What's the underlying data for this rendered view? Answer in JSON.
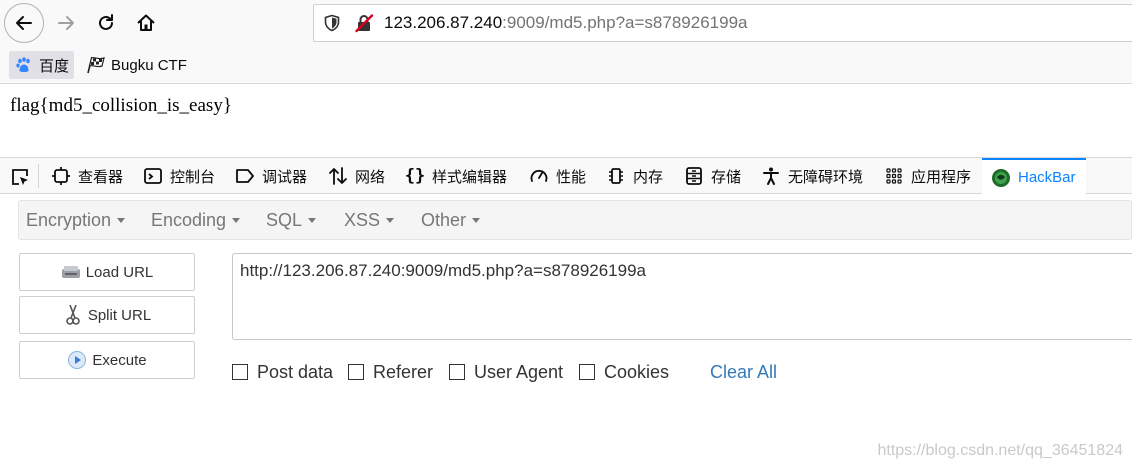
{
  "browser": {
    "url_host": "123.206.87.240",
    "url_rest": ":9009/md5.php?a=s878926199a",
    "bookmarks": [
      {
        "label": "百度",
        "icon": "baidu-paw-icon"
      },
      {
        "label": "Bugku CTF",
        "icon": "checkered-flag-icon"
      }
    ]
  },
  "page": {
    "flag_text": "flag{md5_collision_is_easy}"
  },
  "devtools": {
    "tabs": [
      {
        "label": "查看器",
        "icon": "inspector-icon"
      },
      {
        "label": "控制台",
        "icon": "console-icon"
      },
      {
        "label": "调试器",
        "icon": "debugger-icon"
      },
      {
        "label": "网络",
        "icon": "network-icon"
      },
      {
        "label": "样式编辑器",
        "icon": "style-editor-icon"
      },
      {
        "label": "性能",
        "icon": "performance-icon"
      },
      {
        "label": "内存",
        "icon": "memory-icon"
      },
      {
        "label": "存储",
        "icon": "storage-icon"
      },
      {
        "label": "无障碍环境",
        "icon": "accessibility-icon"
      },
      {
        "label": "应用程序",
        "icon": "application-icon"
      },
      {
        "label": "HackBar",
        "icon": "hackbar-icon",
        "active": true
      }
    ],
    "active_color": "#0a84ff"
  },
  "hackbar": {
    "menus": [
      "Encryption",
      "Encoding",
      "SQL",
      "XSS",
      "Other"
    ],
    "buttons": {
      "load": "Load URL",
      "split": "Split URL",
      "execute": "Execute"
    },
    "url_value": "http://123.206.87.240:9009/md5.php?a=s878926199a",
    "options": [
      "Post data",
      "Referer",
      "User Agent",
      "Cookies"
    ],
    "clear_all": "Clear All",
    "link_color": "#337ab7"
  },
  "watermark": "https://blog.csdn.net/qq_36451824"
}
